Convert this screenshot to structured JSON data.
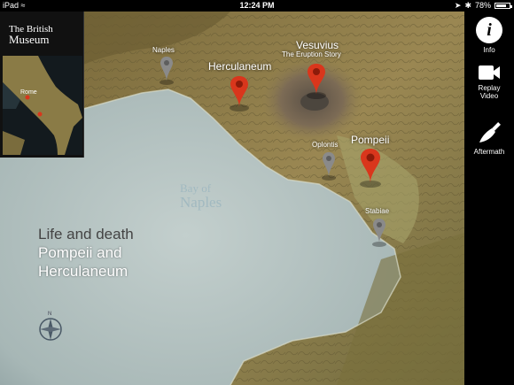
{
  "status_bar": {
    "device": "iPad",
    "time": "12:24 PM",
    "battery": "78%",
    "battery_level": 0.78
  },
  "museum": {
    "logo_line1": "The British",
    "logo_line2": "Museum",
    "minimap_label": "Rome"
  },
  "panel": {
    "info_label": "Info",
    "replay_label1": "Replay",
    "replay_label2": "Video",
    "aftermath_label": "Aftermath"
  },
  "map": {
    "naples": "Naples",
    "herculaneum": "Herculaneum",
    "vesuvius": "Vesuvius",
    "vesuvius_sub": "The Eruption Story",
    "oplontis": "Oplontis",
    "pompeii": "Pompeii",
    "stabiae": "Stabiae",
    "bay_line1": "Bay of",
    "bay_line2": "Naples",
    "compass_n": "N"
  },
  "title": {
    "line1": "Life and death",
    "line2": "Pompeii and",
    "line3": "Herculaneum"
  },
  "colors": {
    "sea": "#b9c6c4",
    "land": "#8b7a45",
    "pin_red": "#d9361c",
    "pin_grey": "#8a8a8a"
  }
}
